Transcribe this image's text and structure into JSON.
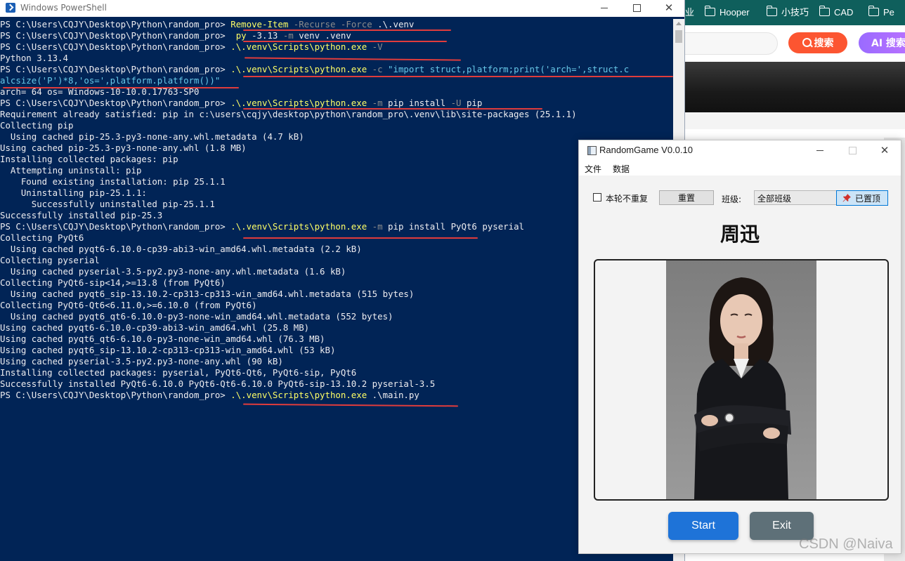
{
  "browser": {
    "bookmarks": [
      "业",
      "Hooper",
      "小技巧",
      "CAD",
      "Pe"
    ],
    "search_button": "搜索",
    "ai_button": "AI 搜索"
  },
  "powershell": {
    "title": "Windows PowerShell",
    "lines": [
      [
        [
          "PS C:\\Users\\CQJY\\Desktop\\Python\\random_pro> ",
          "out"
        ],
        [
          "Remove-Item",
          "cmd"
        ],
        [
          " -Recurse -Force",
          "par"
        ],
        [
          " .\\.venv",
          "out"
        ]
      ],
      [
        [
          "PS C:\\Users\\CQJY\\Desktop\\Python\\random_pro> ",
          "out"
        ],
        [
          " py",
          "cmd"
        ],
        [
          " -3.13 ",
          "out"
        ],
        [
          "-m",
          "par"
        ],
        [
          " venv .venv",
          "out"
        ]
      ],
      [
        [
          "PS C:\\Users\\CQJY\\Desktop\\Python\\random_pro> ",
          "out"
        ],
        [
          ".\\.venv\\Scripts\\python.exe",
          "cmd"
        ],
        [
          " -V",
          "par"
        ]
      ],
      [
        [
          "Python 3.13.4",
          "out"
        ]
      ],
      [
        [
          "PS C:\\Users\\CQJY\\Desktop\\Python\\random_pro> ",
          "out"
        ],
        [
          ".\\.venv\\Scripts\\python.exe",
          "cmd"
        ],
        [
          " -c",
          "par"
        ],
        [
          " \"import struct,platform;print('arch=',struct.c",
          "str"
        ]
      ],
      [
        [
          "alcsize('P')*8,'os=',platform.platform())\"",
          "str"
        ]
      ],
      [
        [
          "arch= 64 os= Windows-10-10.0.17763-SP0",
          "out"
        ]
      ],
      [
        [
          "PS C:\\Users\\CQJY\\Desktop\\Python\\random_pro> ",
          "out"
        ],
        [
          ".\\.venv\\Scripts\\python.exe",
          "cmd"
        ],
        [
          " -m",
          "par"
        ],
        [
          " pip install ",
          "out"
        ],
        [
          "-U",
          "par"
        ],
        [
          " pip",
          "out"
        ]
      ],
      [
        [
          "Requirement already satisfied: pip in c:\\users\\cqjy\\desktop\\python\\random_pro\\.venv\\lib\\site-packages (25.1.1)",
          "out"
        ]
      ],
      [
        [
          "Collecting pip",
          "out"
        ]
      ],
      [
        [
          "  Using cached pip-25.3-py3-none-any.whl.metadata (4.7 kB)",
          "out"
        ]
      ],
      [
        [
          "Using cached pip-25.3-py3-none-any.whl (1.8 MB)",
          "out"
        ]
      ],
      [
        [
          "Installing collected packages: pip",
          "out"
        ]
      ],
      [
        [
          "  Attempting uninstall: pip",
          "out"
        ]
      ],
      [
        [
          "    Found existing installation: pip 25.1.1",
          "out"
        ]
      ],
      [
        [
          "    Uninstalling pip-25.1.1:",
          "out"
        ]
      ],
      [
        [
          "      Successfully uninstalled pip-25.1.1",
          "out"
        ]
      ],
      [
        [
          "Successfully installed pip-25.3",
          "out"
        ]
      ],
      [
        [
          "PS C:\\Users\\CQJY\\Desktop\\Python\\random_pro> ",
          "out"
        ],
        [
          ".\\.venv\\Scripts\\python.exe",
          "cmd"
        ],
        [
          " -m",
          "par"
        ],
        [
          " pip install PyQt6 pyserial",
          "out"
        ]
      ],
      [
        [
          "Collecting PyQt6",
          "out"
        ]
      ],
      [
        [
          "  Using cached pyqt6-6.10.0-cp39-abi3-win_amd64.whl.metadata (2.2 kB)",
          "out"
        ]
      ],
      [
        [
          "Collecting pyserial",
          "out"
        ]
      ],
      [
        [
          "  Using cached pyserial-3.5-py2.py3-none-any.whl.metadata (1.6 kB)",
          "out"
        ]
      ],
      [
        [
          "Collecting PyQt6-sip<14,>=13.8 (from PyQt6)",
          "out"
        ]
      ],
      [
        [
          "  Using cached pyqt6_sip-13.10.2-cp313-cp313-win_amd64.whl.metadata (515 bytes)",
          "out"
        ]
      ],
      [
        [
          "Collecting PyQt6-Qt6<6.11.0,>=6.10.0 (from PyQt6)",
          "out"
        ]
      ],
      [
        [
          "  Using cached pyqt6_qt6-6.10.0-py3-none-win_amd64.whl.metadata (552 bytes)",
          "out"
        ]
      ],
      [
        [
          "Using cached pyqt6-6.10.0-cp39-abi3-win_amd64.whl (25.8 MB)",
          "out"
        ]
      ],
      [
        [
          "Using cached pyqt6_qt6-6.10.0-py3-none-win_amd64.whl (76.3 MB)",
          "out"
        ]
      ],
      [
        [
          "Using cached pyqt6_sip-13.10.2-cp313-cp313-win_amd64.whl (53 kB)",
          "out"
        ]
      ],
      [
        [
          "Using cached pyserial-3.5-py2.py3-none-any.whl (90 kB)",
          "out"
        ]
      ],
      [
        [
          "Installing collected packages: pyserial, PyQt6-Qt6, PyQt6-sip, PyQt6",
          "out"
        ]
      ],
      [
        [
          "Successfully installed PyQt6-6.10.0 PyQt6-Qt6-6.10.0 PyQt6-sip-13.10.2 pyserial-3.5",
          "out"
        ]
      ],
      [
        [
          "PS C:\\Users\\CQJY\\Desktop\\Python\\random_pro> ",
          "out"
        ],
        [
          ".\\.venv\\Scripts\\python.exe",
          "cmd"
        ],
        [
          " .\\main.py",
          "out"
        ]
      ]
    ],
    "colors": {
      "background": "#012456",
      "command": "#ffff66",
      "parameter": "#8c8c8c",
      "string": "#67c8e8",
      "output": "#eeedf0",
      "annotation_underline": "#e03c3c"
    }
  },
  "app": {
    "title": "RandomGame V0.0.10",
    "menu": [
      "文件",
      "数据"
    ],
    "no_repeat_label": "本轮不重复",
    "no_repeat_checked": false,
    "reset_label": "重置",
    "class_label": "班级:",
    "class_value": "全部班级",
    "pin_label": "已置顶",
    "selected_name": "周迅",
    "start_label": "Start",
    "exit_label": "Exit",
    "colors": {
      "start": "#1e73d8",
      "exit": "#5e7078",
      "pin_active": "#cce4f7"
    }
  },
  "watermark": "CSDN @Naiva"
}
